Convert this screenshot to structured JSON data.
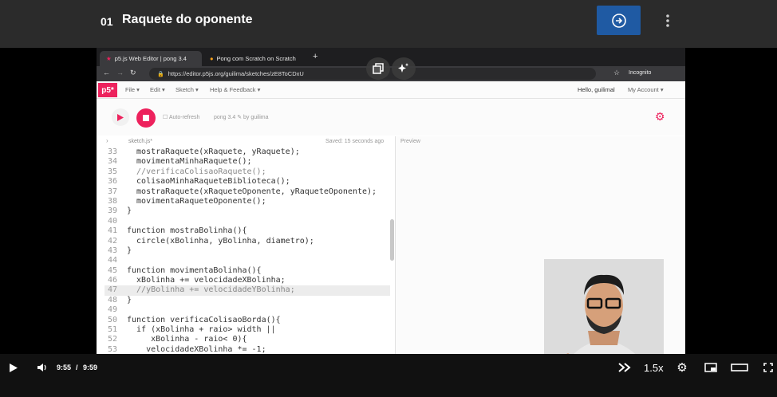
{
  "header": {
    "lesson_number": "01",
    "lesson_title": "Raquete do oponente"
  },
  "browser": {
    "tabs": [
      "p5.js Web Editor | pong 3.4",
      "Pong com Scratch on Scratch"
    ],
    "url": "https://editor.p5js.org/guilima/sketches/zE8ToCDxU",
    "incognito": "Incognito"
  },
  "p5": {
    "logo": "p5*",
    "menu": [
      "File ▾",
      "Edit ▾",
      "Sketch ▾",
      "Help & Feedback ▾"
    ],
    "greeting": "Hello, guilimal",
    "account": "My Account ▾",
    "auto_refresh": "Auto-refresh",
    "sketch_name": "pong 3.4 ✎ by guilima",
    "file": "sketch.js*",
    "saved": "Saved: 15 seconds ago",
    "preview": "Preview"
  },
  "code": [
    {
      "n": "33",
      "t": "  mostraRaquete(xRaquete, yRaquete);"
    },
    {
      "n": "34",
      "t": "  movimentaMinhaRaquete();"
    },
    {
      "n": "35",
      "t": "  //verificaColisaoRaquete();"
    },
    {
      "n": "36",
      "t": "  colisaoMinhaRaqueteBiblioteca();"
    },
    {
      "n": "37",
      "t": "  mostraRaquete(xRaqueteOponente, yRaqueteOponente);"
    },
    {
      "n": "38",
      "t": "  movimentaRaqueteOponente();"
    },
    {
      "n": "39",
      "t": "}"
    },
    {
      "n": "40",
      "t": ""
    },
    {
      "n": "41",
      "t": "function mostraBolinha(){"
    },
    {
      "n": "42",
      "t": "  circle(xBolinha, yBolinha, diametro);"
    },
    {
      "n": "43",
      "t": "}"
    },
    {
      "n": "44",
      "t": ""
    },
    {
      "n": "45",
      "t": "function movimentaBolinha(){"
    },
    {
      "n": "46",
      "t": "  xBolinha += velocidadeXBolinha;"
    },
    {
      "n": "47",
      "t": "  //yBolinha += velocidadeYBolinha;"
    },
    {
      "n": "48",
      "t": "}"
    },
    {
      "n": "49",
      "t": ""
    },
    {
      "n": "50",
      "t": "function verificaColisaoBorda(){"
    },
    {
      "n": "51",
      "t": "  if (xBolinha + raio> width ||"
    },
    {
      "n": "52",
      "t": "     xBolinha - raio< 0){"
    },
    {
      "n": "53",
      "t": "    velocidadeXBolinha *= -1;"
    },
    {
      "n": "",
      "t": "  }"
    }
  ],
  "player": {
    "current": "9:55",
    "sep": "/",
    "total": "9:59",
    "speed": "1.5x"
  },
  "colors": {
    "accent": "#1f5aa3",
    "progress": "#1f6fe0",
    "p5": "#ed225d"
  }
}
